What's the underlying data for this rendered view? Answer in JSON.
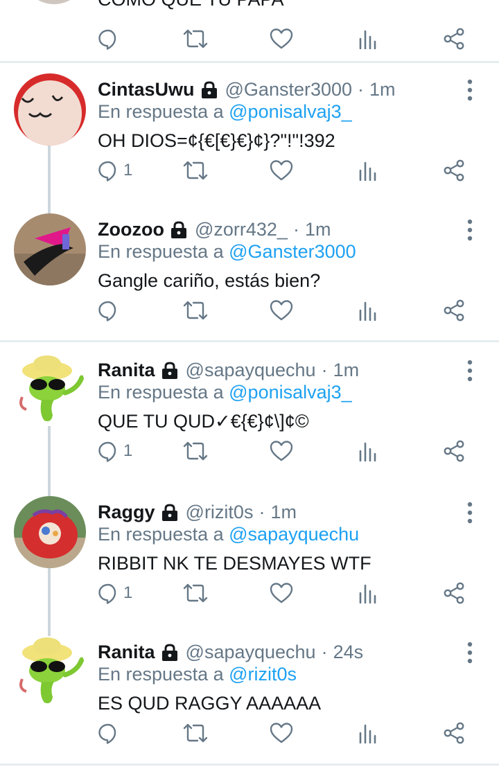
{
  "top_tweet": {
    "text": "COMO QUE TU PAPA"
  },
  "tweets": [
    {
      "name": "CintasUwu",
      "handle": "@Ganster3000",
      "dot": "·",
      "time": "1m",
      "reply_prefix": "En respuesta a",
      "reply_to": "@ponisalvaj3_",
      "text": "OH DIOS=¢{€[€}€}¢}?\"!\"!392",
      "reply_count": "1"
    },
    {
      "name": "Zoozoo",
      "handle": "@zorr432_",
      "dot": "·",
      "time": "1m",
      "reply_prefix": "En respuesta a",
      "reply_to": "@Ganster3000",
      "text": "Gangle cariño, estás bien?",
      "reply_count": ""
    },
    {
      "name": "Ranita",
      "handle": "@sapayquechu",
      "dot": "·",
      "time": "1m",
      "reply_prefix": "En respuesta a",
      "reply_to": "@ponisalvaj3_",
      "text": "QUE TU QUD✓€{€}¢\\]¢©",
      "reply_count": "1"
    },
    {
      "name": "Raggy",
      "handle": "@rizit0s",
      "dot": "·",
      "time": "1m",
      "reply_prefix": "En respuesta a",
      "reply_to": "@sapayquechu",
      "text": "RIBBIT NK TE DESMAYES WTF",
      "reply_count": "1"
    },
    {
      "name": "Ranita",
      "handle": "@sapayquechu",
      "dot": "·",
      "time": "24s",
      "reply_prefix": "En respuesta a",
      "reply_to": "@rizit0s",
      "text": "ES QUD RAGGY AAAAAA",
      "reply_count": ""
    }
  ],
  "icons": {
    "reply": "reply-icon",
    "retweet": "retweet-icon",
    "like": "heart-icon",
    "stats": "analytics-icon",
    "share": "share-icon",
    "lock": "lock-icon",
    "more": "more-vertical-icon"
  },
  "colors": {
    "mention": "#1da1f2",
    "secondary_text": "#657786",
    "divider": "#e6ecf0",
    "thread_line": "#ccd6dd"
  }
}
